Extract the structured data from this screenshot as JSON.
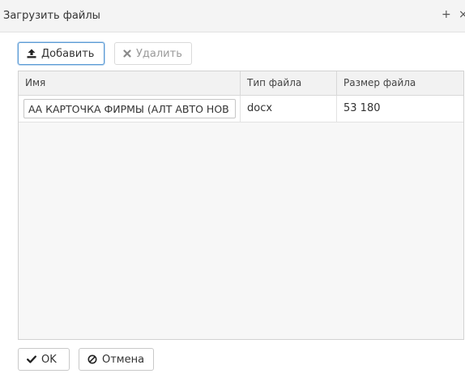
{
  "dialog": {
    "title": "Загрузить файлы",
    "plus_label": "+",
    "close_label": "×"
  },
  "toolbar": {
    "add_label": "Добавить",
    "add_icon": "upload-icon",
    "delete_label": "Удалить",
    "delete_icon": "close-icon"
  },
  "table": {
    "columns": [
      "Имя",
      "Тип файла",
      "Размер файла"
    ],
    "rows": [
      {
        "name": "АА КАРТОЧКА ФИРМЫ (АЛТ АВТО НОВ",
        "type": "docx",
        "size": "53 180"
      }
    ]
  },
  "footer": {
    "ok_label": "OK",
    "ok_icon": "check-icon",
    "cancel_label": "Отмена",
    "cancel_icon": "ban-icon"
  },
  "colors": {
    "accent_border": "#5b9bd5",
    "header_bg": "#f2f2f2",
    "grid_bg": "#f7f7f7"
  }
}
